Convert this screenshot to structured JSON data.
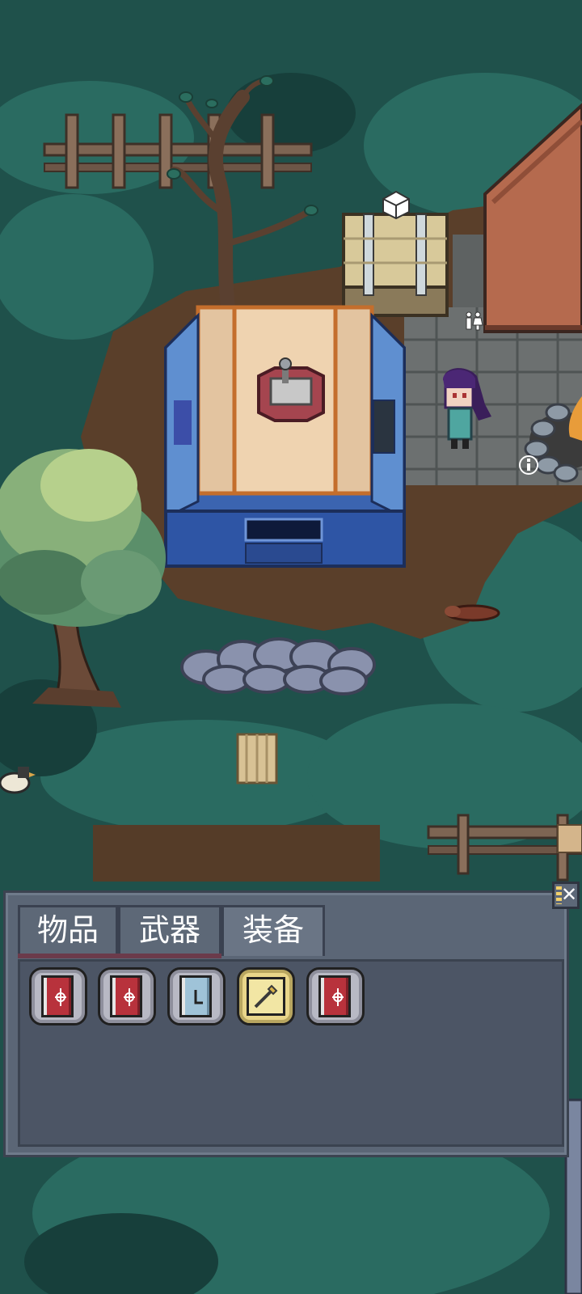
{
  "inventory": {
    "tabs": [
      {
        "label": "物品",
        "active": false
      },
      {
        "label": "武器",
        "active": false
      },
      {
        "label": "装备",
        "active": true
      }
    ],
    "close_label": "✕",
    "slots": [
      {
        "item": "red-spellbook",
        "frame": "gray"
      },
      {
        "item": "red-spellbook",
        "frame": "gray"
      },
      {
        "item": "blue-manual",
        "frame": "gray"
      },
      {
        "item": "sword-card",
        "frame": "yellow"
      },
      {
        "item": "red-spellbook",
        "frame": "gray"
      }
    ]
  },
  "scene": {
    "markers": {
      "crate_marker": "box-icon",
      "toilet_marker": "restroom-icon",
      "info_marker": "ⓘ"
    }
  },
  "colors": {
    "grass_dark": "#1e4f4a",
    "grass_mid": "#2a6a60",
    "dirt": "#5a3f2a",
    "panel": "#5b6676",
    "panel_border": "#3b4350"
  }
}
